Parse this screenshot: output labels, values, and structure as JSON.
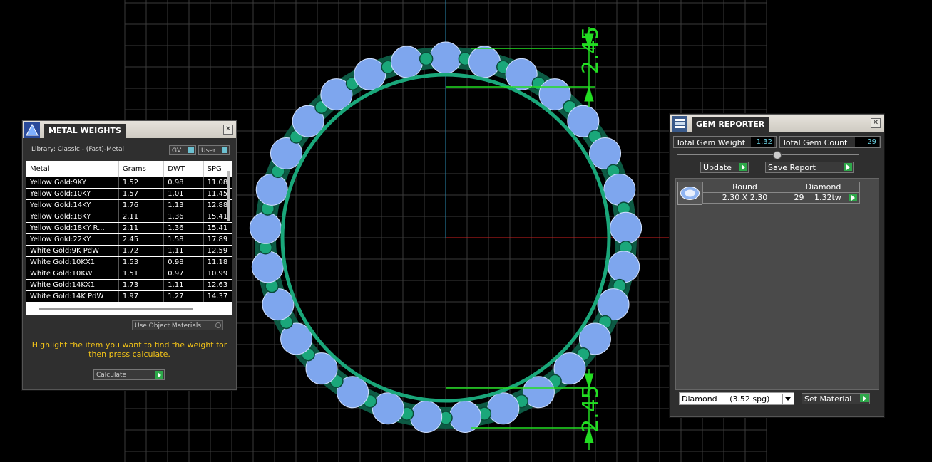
{
  "viewport": {
    "dimension_top": "2.45",
    "dimension_bottom": "2.45",
    "colors": {
      "grid": "#3a3a3a",
      "ring": "#1aa77a",
      "gems": "#7ea6ee",
      "dimension": "#22dd22",
      "axis_red": "#d02020",
      "axis_blue": "#2a8ab0"
    }
  },
  "metal_weights": {
    "title": "METAL WEIGHTS",
    "library": "Library: Classic - (Fast)-Metal",
    "toggle_gv": "GV",
    "toggle_user": "User",
    "columns": [
      "Metal",
      "Grams",
      "DWT",
      "SPG"
    ],
    "rows": [
      [
        "Yellow Gold:9KY",
        "1.52",
        "0.98",
        "11.08"
      ],
      [
        "Yellow Gold:10KY",
        "1.57",
        "1.01",
        "11.45"
      ],
      [
        "Yellow Gold:14KY",
        "1.76",
        "1.13",
        "12.88"
      ],
      [
        "Yellow Gold:18KY",
        "2.11",
        "1.36",
        "15.41"
      ],
      [
        "Yellow Gold:18KY R...",
        "2.11",
        "1.36",
        "15.41"
      ],
      [
        "Yellow Gold:22KY",
        "2.45",
        "1.58",
        "17.89"
      ],
      [
        "White Gold:9K PdW",
        "1.72",
        "1.11",
        "12.59"
      ],
      [
        "White Gold:10KX1",
        "1.53",
        "0.98",
        "11.18"
      ],
      [
        "White Gold:10KW",
        "1.51",
        "0.97",
        "10.99"
      ],
      [
        "White Gold:14KX1",
        "1.73",
        "1.11",
        "12.63"
      ],
      [
        "White Gold:14K PdW",
        "1.97",
        "1.27",
        "14.37"
      ]
    ],
    "use_object_materials": "Use Object Materials",
    "hint": "Highlight the item you want to find the weight for then press calculate.",
    "calculate": "Calculate"
  },
  "gem_reporter": {
    "title": "GEM REPORTER",
    "total_weight_label": "Total Gem Weight",
    "total_weight_value": "1.32",
    "total_count_label": "Total Gem Count",
    "total_count_value": "29",
    "update": "Update",
    "save_report": "Save Report",
    "gem": {
      "shape": "Round",
      "material": "Diamond",
      "size": "2.30 X 2.30",
      "count": "29",
      "weight": "1.32tw"
    },
    "material_select": "Diamond     (3.52 spg)",
    "set_material": "Set Material"
  }
}
